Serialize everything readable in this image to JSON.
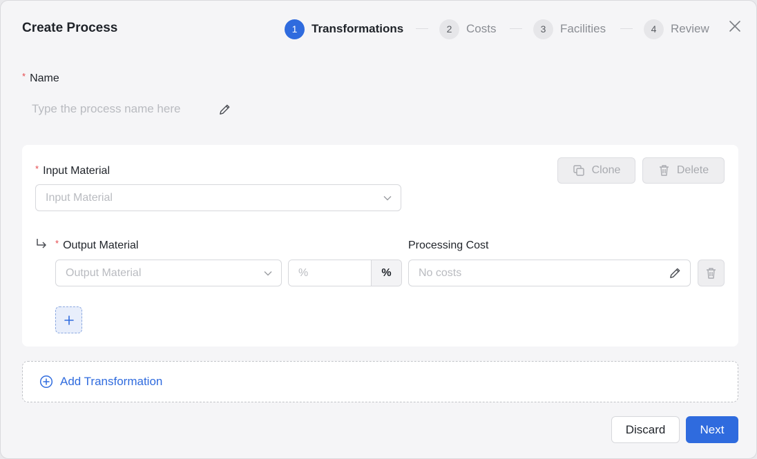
{
  "dialog": {
    "title": "Create Process",
    "steps": [
      {
        "num": "1",
        "label": "Transformations",
        "active": true
      },
      {
        "num": "2",
        "label": "Costs",
        "active": false
      },
      {
        "num": "3",
        "label": "Facilities",
        "active": false
      },
      {
        "num": "4",
        "label": "Review",
        "active": false
      }
    ],
    "close_icon": "close-icon"
  },
  "name_field": {
    "required_mark": "*",
    "label": "Name",
    "placeholder": "Type the process name here",
    "value": ""
  },
  "transformation": {
    "input_material": {
      "required_mark": "*",
      "label": "Input Material",
      "placeholder": "Input Material"
    },
    "clone_label": "Clone",
    "delete_label": "Delete",
    "output_material": {
      "required_mark": "*",
      "label": "Output Material",
      "placeholder": "Output Material"
    },
    "percent": {
      "placeholder": "%",
      "addon": "%"
    },
    "processing_cost": {
      "label": "Processing Cost",
      "value": "No costs"
    }
  },
  "add_transformation_label": "Add Transformation",
  "footer": {
    "discard_label": "Discard",
    "next_label": "Next"
  },
  "colors": {
    "primary": "#2f6bde",
    "required": "#e5484d",
    "background": "#f5f5f7"
  }
}
